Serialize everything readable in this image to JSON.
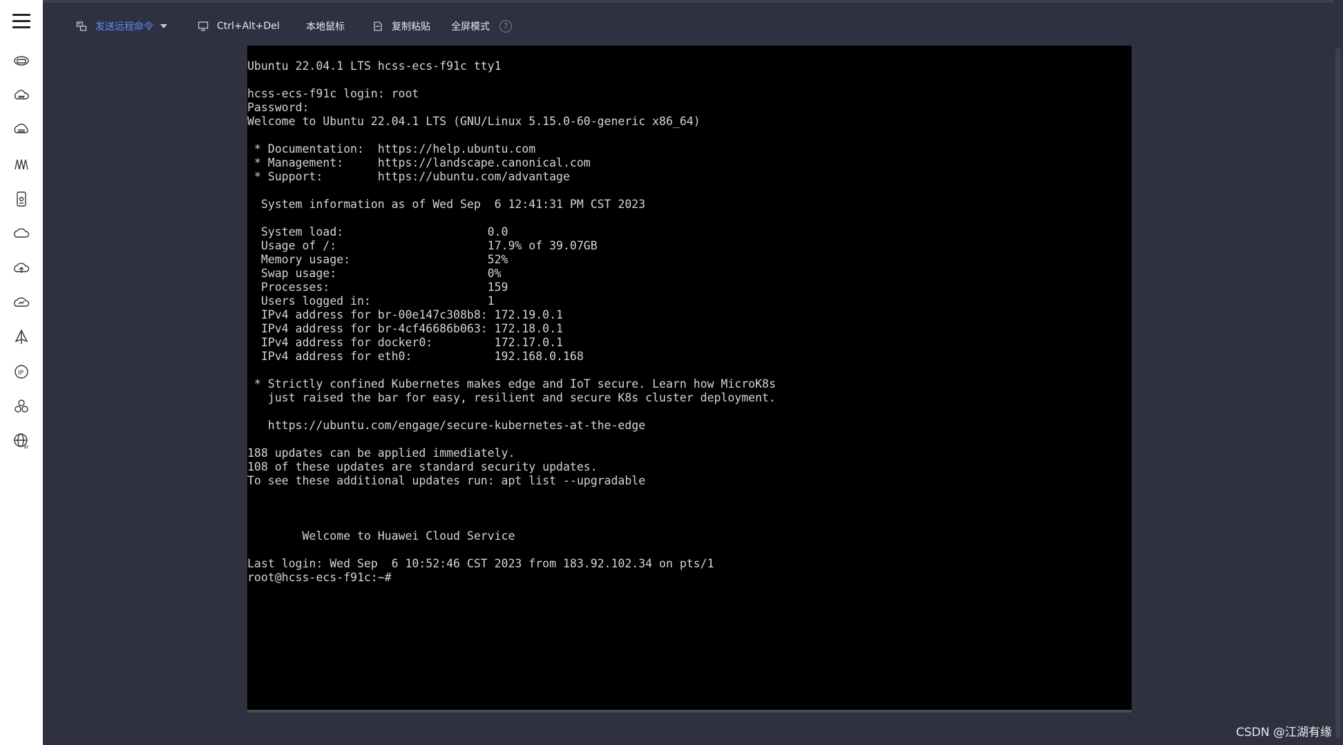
{
  "toolbar": {
    "send_remote_command": "发送远程命令",
    "ctrl_alt_del": "Ctrl+Alt+Del",
    "local_mouse": "本地鼠标",
    "copy_paste": "复制粘贴",
    "fullscreen": "全屏模式",
    "help": "?"
  },
  "sidebar": {
    "icons": [
      "cloud-server-icon",
      "cloud-icon",
      "database-icon",
      "network-icon",
      "storage-icon",
      "cloud-cycle-icon",
      "cloud-upload-icon",
      "cloud-monitor-icon",
      "deploy-icon",
      "ip-icon",
      "cluster-icon",
      "web-globe-icon"
    ]
  },
  "terminal": {
    "lines": [
      "Ubuntu 22.04.1 LTS hcss-ecs-f91c tty1",
      "",
      "hcss-ecs-f91c login: root",
      "Password:",
      "Welcome to Ubuntu 22.04.1 LTS (GNU/Linux 5.15.0-60-generic x86_64)",
      "",
      " * Documentation:  https://help.ubuntu.com",
      " * Management:     https://landscape.canonical.com",
      " * Support:        https://ubuntu.com/advantage",
      "",
      "  System information as of Wed Sep  6 12:41:31 PM CST 2023",
      "",
      "  System load:                     0.0",
      "  Usage of /:                      17.9% of 39.07GB",
      "  Memory usage:                    52%",
      "  Swap usage:                      0%",
      "  Processes:                       159",
      "  Users logged in:                 1",
      "  IPv4 address for br-00e147c308b8: 172.19.0.1",
      "  IPv4 address for br-4cf46686b063: 172.18.0.1",
      "  IPv4 address for docker0:         172.17.0.1",
      "  IPv4 address for eth0:            192.168.0.168",
      "",
      " * Strictly confined Kubernetes makes edge and IoT secure. Learn how MicroK8s",
      "   just raised the bar for easy, resilient and secure K8s cluster deployment.",
      "",
      "   https://ubuntu.com/engage/secure-kubernetes-at-the-edge",
      "",
      "188 updates can be applied immediately.",
      "108 of these updates are standard security updates.",
      "To see these additional updates run: apt list --upgradable",
      "",
      "",
      "",
      "        Welcome to Huawei Cloud Service",
      "",
      "Last login: Wed Sep  6 10:52:46 CST 2023 from 183.92.102.34 on pts/1",
      "root@hcss-ecs-f91c:~#"
    ]
  },
  "watermark": "CSDN @江湖有缘",
  "colors": {
    "accent": "#5b8df5",
    "background": "#2f3140",
    "terminal_bg": "#000000",
    "terminal_fg": "#d6d6d6"
  }
}
